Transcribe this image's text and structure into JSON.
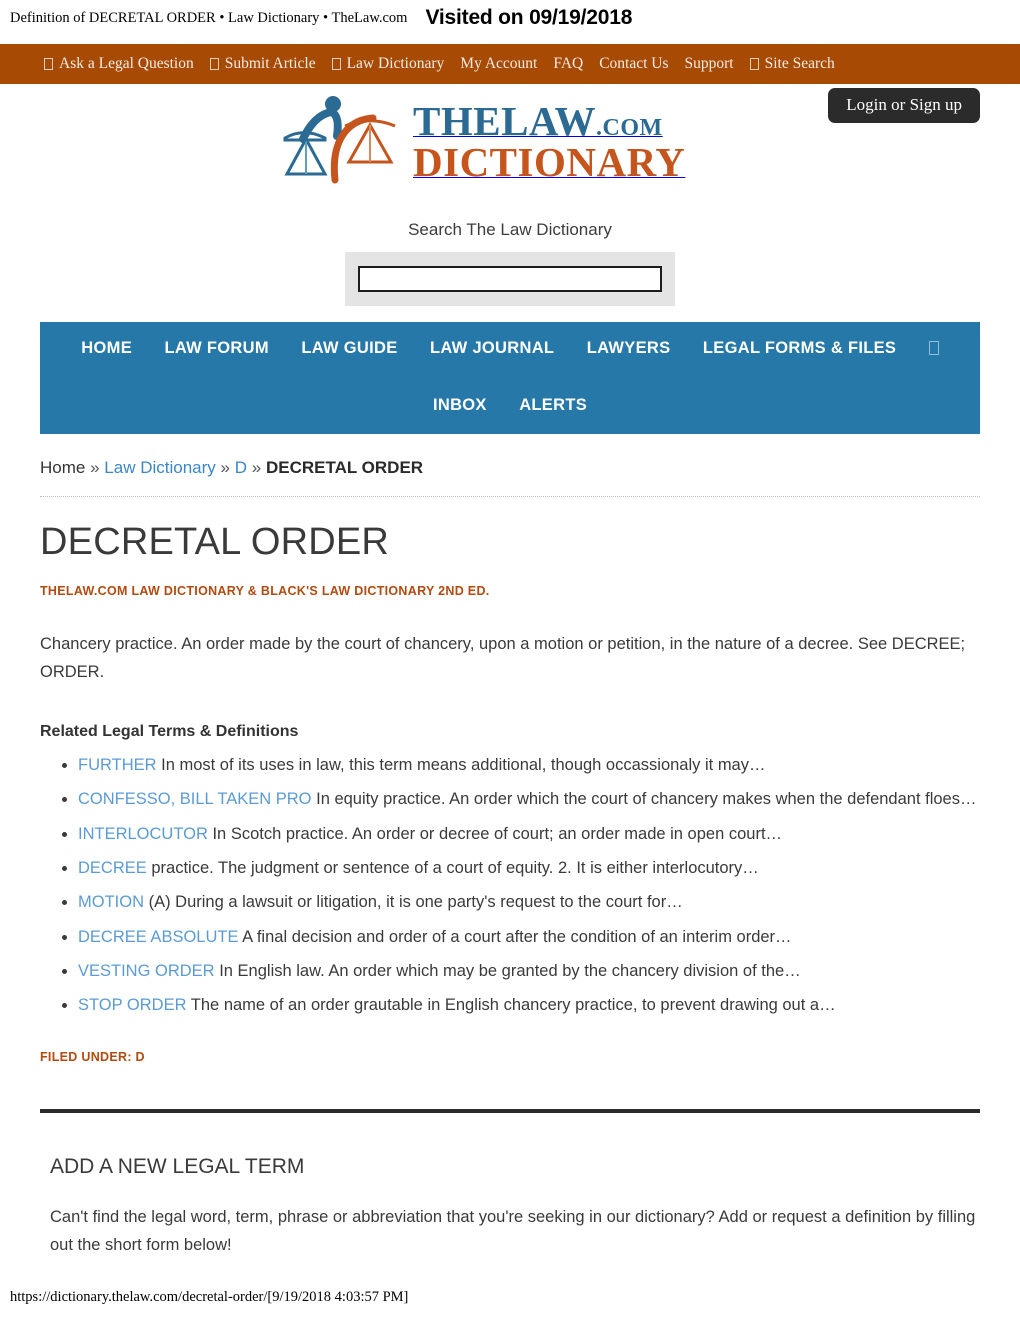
{
  "print": {
    "document_title": "Definition of DECRETAL ORDER • Law Dictionary • TheLaw.com",
    "visited": "Visited on 09/19/2018",
    "footer": "https://dictionary.thelaw.com/decretal-order/[9/19/2018 4:03:57 PM]"
  },
  "colors": {
    "topbar_orange": "#a64a04",
    "nav_blue": "#2578a8",
    "link_blue": "#5b9bd5",
    "accent_orange": "#b44a10",
    "login_dark": "#2b2b2b"
  },
  "topbar": {
    "items": [
      {
        "label": "Ask a Legal Question",
        "icon": "missing-glyph-icon",
        "has_icon": true
      },
      {
        "label": "Submit Article",
        "icon": "missing-glyph-icon",
        "has_icon": true
      },
      {
        "label": "Law Dictionary",
        "icon": "missing-glyph-icon",
        "has_icon": true
      },
      {
        "label": "My Account",
        "icon": "",
        "has_icon": false
      },
      {
        "label": "FAQ",
        "icon": "",
        "has_icon": false
      },
      {
        "label": "Contact Us",
        "icon": "",
        "has_icon": false
      },
      {
        "label": "Support",
        "icon": "",
        "has_icon": false
      },
      {
        "label": "Site Search",
        "icon": "missing-glyph-icon",
        "has_icon": true
      }
    ],
    "login_label": "Login or Sign up"
  },
  "logo": {
    "line1_main": "THELAW",
    "line1_suffix": ".COM",
    "line2": "DICTIONARY",
    "alt": "TheLaw.com Dictionary scales of justice logo"
  },
  "search": {
    "label": "Search The Law Dictionary",
    "value": "",
    "placeholder": ""
  },
  "mainnav": {
    "row1": [
      {
        "label": "HOME"
      },
      {
        "label": "LAW FORUM"
      },
      {
        "label": "LAW GUIDE"
      },
      {
        "label": "LAW JOURNAL"
      },
      {
        "label": "LAWYERS"
      },
      {
        "label": "LEGAL FORMS & FILES"
      }
    ],
    "row1_trailing_icon": "missing-glyph-icon",
    "row2": [
      {
        "label": "INBOX"
      },
      {
        "label": "ALERTS"
      }
    ]
  },
  "breadcrumb": {
    "home": "Home",
    "section": "Law Dictionary",
    "letter": "D",
    "current": "DECRETAL ORDER",
    "separator": "»"
  },
  "entry": {
    "title": "DECRETAL ORDER",
    "source": "THELAW.COM LAW DICTIONARY & BLACK'S LAW DICTIONARY 2ND ED.",
    "definition": "Chancery practice. An order made by the court of chancery, upon a motion or petition, in the nature of a decree. See DECREE; ORDER.",
    "filed_under": "FILED UNDER: D"
  },
  "related": {
    "heading": "Related Legal Terms & Definitions",
    "items": [
      {
        "term": "FURTHER",
        "snippet": "In most of its uses in law, this term means additional, though occassionaly it may…"
      },
      {
        "term": "CONFESSO, BILL TAKEN PRO",
        "snippet": "In equity practice. An order which the court of chancery makes when the defendant floes…"
      },
      {
        "term": "INTERLOCUTOR",
        "snippet": "In Scotch practice. An order or decree of court; an order made in open court…"
      },
      {
        "term": "DECREE",
        "snippet": "practice. The judgment or sentence of a court of equity. 2. It is either interlocutory…"
      },
      {
        "term": "MOTION",
        "snippet": "(A) During a lawsuit or litigation, it is one party's request to the court for…"
      },
      {
        "term": "DECREE ABSOLUTE",
        "snippet": "A final decision and order of a court after the condition of an interim order…"
      },
      {
        "term": "VESTING ORDER",
        "snippet": "In English law. An order which may be granted by the chancery division of the…"
      },
      {
        "term": "STOP ORDER",
        "snippet": "The name of an order grautable in English chancery practice, to prevent drawing out a…"
      }
    ]
  },
  "add_term": {
    "title": "ADD A NEW LEGAL TERM",
    "body": "Can't find the legal word, term, phrase or abbreviation that you're seeking in our dictionary? Add or request a definition by filling out the short form below!"
  }
}
